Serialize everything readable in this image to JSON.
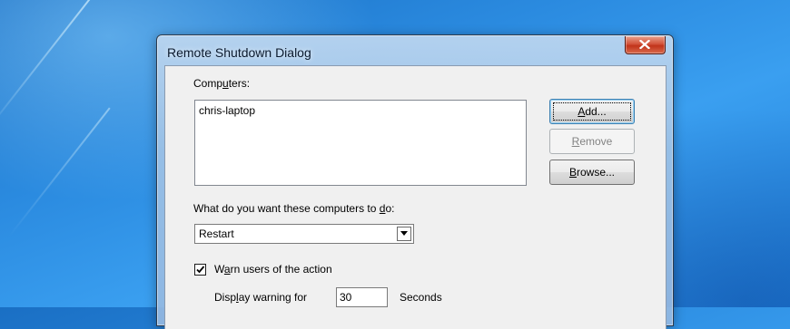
{
  "dialog": {
    "title": "Remote Shutdown Dialog",
    "computers_label_pre": "Comp",
    "computers_label_key": "u",
    "computers_label_post": "ters:",
    "computers": [
      "chris-laptop"
    ],
    "buttons": {
      "add_key": "A",
      "add_rest": "dd...",
      "remove_key": "R",
      "remove_rest": "emove",
      "browse_key": "B",
      "browse_rest": "rowse..."
    },
    "action_label_pre": "What do you want these computers to ",
    "action_label_key": "d",
    "action_label_post": "o:",
    "action_selected": "Restart",
    "warn_pre": "W",
    "warn_key": "a",
    "warn_post": "rn users of the action",
    "warn_checked": true,
    "display_pre": "Disp",
    "display_key": "l",
    "display_post": "ay warning for",
    "warning_seconds": "30",
    "seconds_label": "Seconds"
  },
  "colors": {
    "desktop_blue": "#2b8be0",
    "close_red": "#c1331a",
    "dialog_face": "#f0f0f0"
  },
  "icons": [
    "close-icon",
    "dropdown-arrow-icon",
    "checkmark-icon"
  ]
}
